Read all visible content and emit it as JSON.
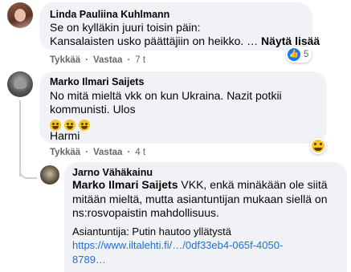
{
  "comments": [
    {
      "author": "Linda Pauliina Kuhlmann",
      "lines": [
        "Se on kylläkin juuri toisin päin:",
        "Kansalaisten usko päättäjiin on heikko. … "
      ],
      "see_more": "Näytä lisää",
      "like": "Tykkää",
      "reply": "Vastaa",
      "time": "7 t",
      "reaction_count": "5",
      "reaction_icon": "like-icon"
    },
    {
      "author": "Marko Ilmari Saijets",
      "lines": [
        "No mitä mieltä vkk on kun Ukraina. Nazit potkii",
        "kommunisti. Ulos"
      ],
      "emojis": [
        "laugh-emoji",
        "laugh-emoji",
        "laugh-emoji"
      ],
      "extra": "Harmi",
      "like": "Tykkää",
      "reply": "Vastaa",
      "time": "4 t",
      "reaction_icon": "haha-icon"
    },
    {
      "author": "Jarno Vähäkainu",
      "mention": "Marko Ilmari Saijets",
      "lines": [
        " VKK, enkä minäkään ole siitä",
        "mitään mieltä, mutta asiantuntijan mukaan siellä on",
        "ns:rosvopaistin mahdollisuus."
      ],
      "quote": "Asiantuntija: Putin hautoo yllätystä",
      "link_lines": [
        "https://www.iltalehti.fi/…/0df33eb4-065f-4050-",
        "8789…"
      ]
    }
  ],
  "colors": {
    "bubble": "#f0f2f5",
    "meta": "#65676b",
    "link": "#216fdb",
    "like_blue": "#1877f2"
  }
}
